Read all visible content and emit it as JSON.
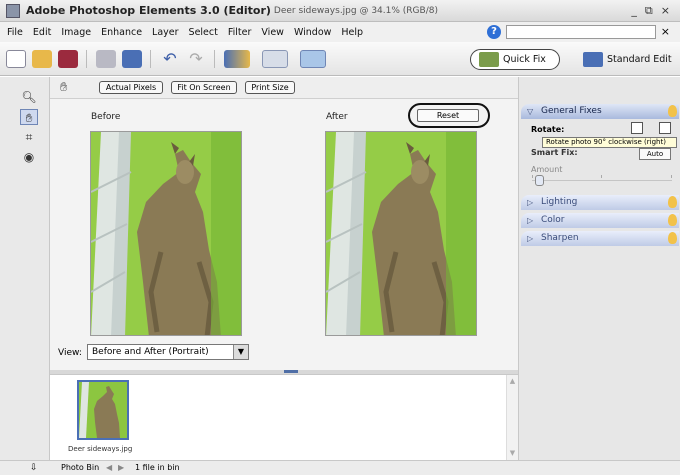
{
  "window": {
    "app_title": "Adobe Photoshop Elements 3.0 (Editor)",
    "doc_title": "Deer sideways.jpg @ 34.1% (RGB/8)",
    "minimize": "_",
    "restore": "á",
    "close": "×"
  },
  "menubar": {
    "items": [
      "File",
      "Edit",
      "Image",
      "Enhance",
      "Layer",
      "Select",
      "Filter",
      "View",
      "Window",
      "Help"
    ],
    "close": "×"
  },
  "modes": {
    "quick_fix": "Quick Fix",
    "standard_edit": "Standard Edit"
  },
  "options": {
    "actual_pixels": "Actual Pixels",
    "fit_on_screen": "Fit On Screen",
    "print_size": "Print Size"
  },
  "workspace": {
    "before_label": "Before",
    "after_label": "After",
    "reset": "Reset",
    "view_label": "View:",
    "view_value": "Before and After (Portrait)"
  },
  "bin": {
    "thumb_caption": "Deer sideways.jpg"
  },
  "palette": {
    "general_fixes": "General Fixes",
    "rotate_label": "Rotate:",
    "tooltip": "Rotate photo 90° clockwise (right)",
    "smart_fix_label": "Smart Fix:",
    "auto": "Auto",
    "amount_label": "Amount",
    "amount_value": 0.05,
    "lighting": "Lighting",
    "color": "Color",
    "sharpen": "Sharpen"
  },
  "statusbar": {
    "photo_bin": "Photo Bin",
    "file_count": "1 file in bin"
  },
  "colors": {
    "quickfix_ring": "#444444",
    "selection_blue": "#4a6fb5",
    "palette_header": "#bfcbe6",
    "grass": "#7fc23b"
  }
}
